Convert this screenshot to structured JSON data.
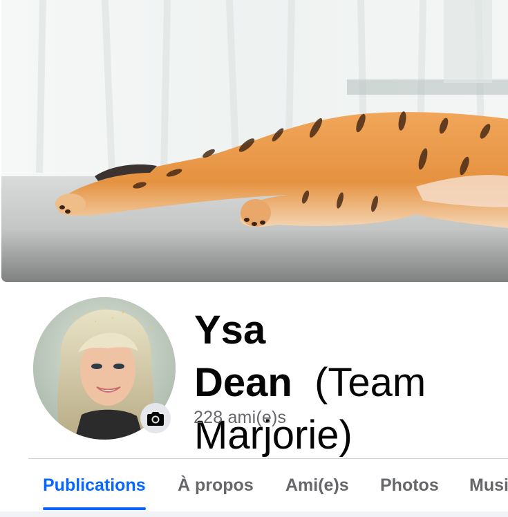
{
  "profile": {
    "first_name": "Ysa Dean",
    "rest_name": "(Team Marjorie)",
    "friends_count": "228 ami(e)s"
  },
  "tabs": [
    {
      "label": "Publications",
      "active": true
    },
    {
      "label": "À propos",
      "active": false
    },
    {
      "label": "Ami(e)s",
      "active": false
    },
    {
      "label": "Photos",
      "active": false
    },
    {
      "label": "Musi",
      "active": false
    }
  ],
  "colors": {
    "accent": "#0866ff",
    "secondary_text": "#65676b",
    "primary_text": "#050505",
    "button_bg": "#e4e6eb"
  },
  "icons": {
    "camera": "camera-icon"
  }
}
